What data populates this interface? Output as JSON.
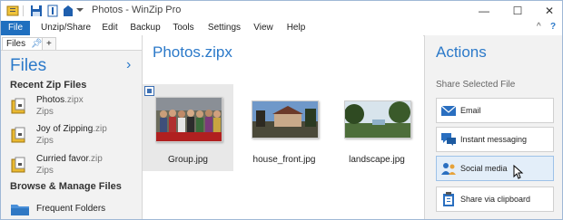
{
  "window": {
    "title": "Photos - WinZip Pro",
    "minimize": "—",
    "maximize": "☐",
    "close": "✕"
  },
  "ribbon": {
    "tabs": [
      "File",
      "Unzip/Share",
      "Edit",
      "Backup",
      "Tools",
      "Settings",
      "View",
      "Help"
    ],
    "collapse": "^",
    "help": "?"
  },
  "left_pane": {
    "tabs": [
      "Files",
      "+"
    ],
    "heading": "Files",
    "recent_heading": "Recent Zip Files",
    "recent": [
      {
        "name": "Photos",
        "ext": ".zipx",
        "type": "Zips"
      },
      {
        "name": "Joy of Zipping",
        "ext": ".zip",
        "type": "Zips"
      },
      {
        "name": "Curried favor",
        "ext": ".zip",
        "type": "Zips"
      }
    ],
    "browse_heading": "Browse & Manage Files",
    "frequent_folders": "Frequent Folders"
  },
  "center": {
    "title": "Photos.zipx",
    "files": [
      {
        "name": "Group.jpg",
        "selected": true
      },
      {
        "name": "house_front.jpg",
        "selected": false
      },
      {
        "name": "landscape.jpg",
        "selected": false
      }
    ]
  },
  "actions": {
    "title": "Actions",
    "section": "Share Selected File",
    "buttons": [
      {
        "label": "Email",
        "icon": "envelope-icon"
      },
      {
        "label": "Instant messaging",
        "icon": "chat-icon"
      },
      {
        "label": "Social media",
        "icon": "people-icon"
      },
      {
        "label": "Share via clipboard",
        "icon": "clipboard-icon"
      }
    ]
  },
  "colors": {
    "accent": "#2b79c9",
    "file_tab": "#1f6fbf",
    "hover": "#e3eef9"
  }
}
